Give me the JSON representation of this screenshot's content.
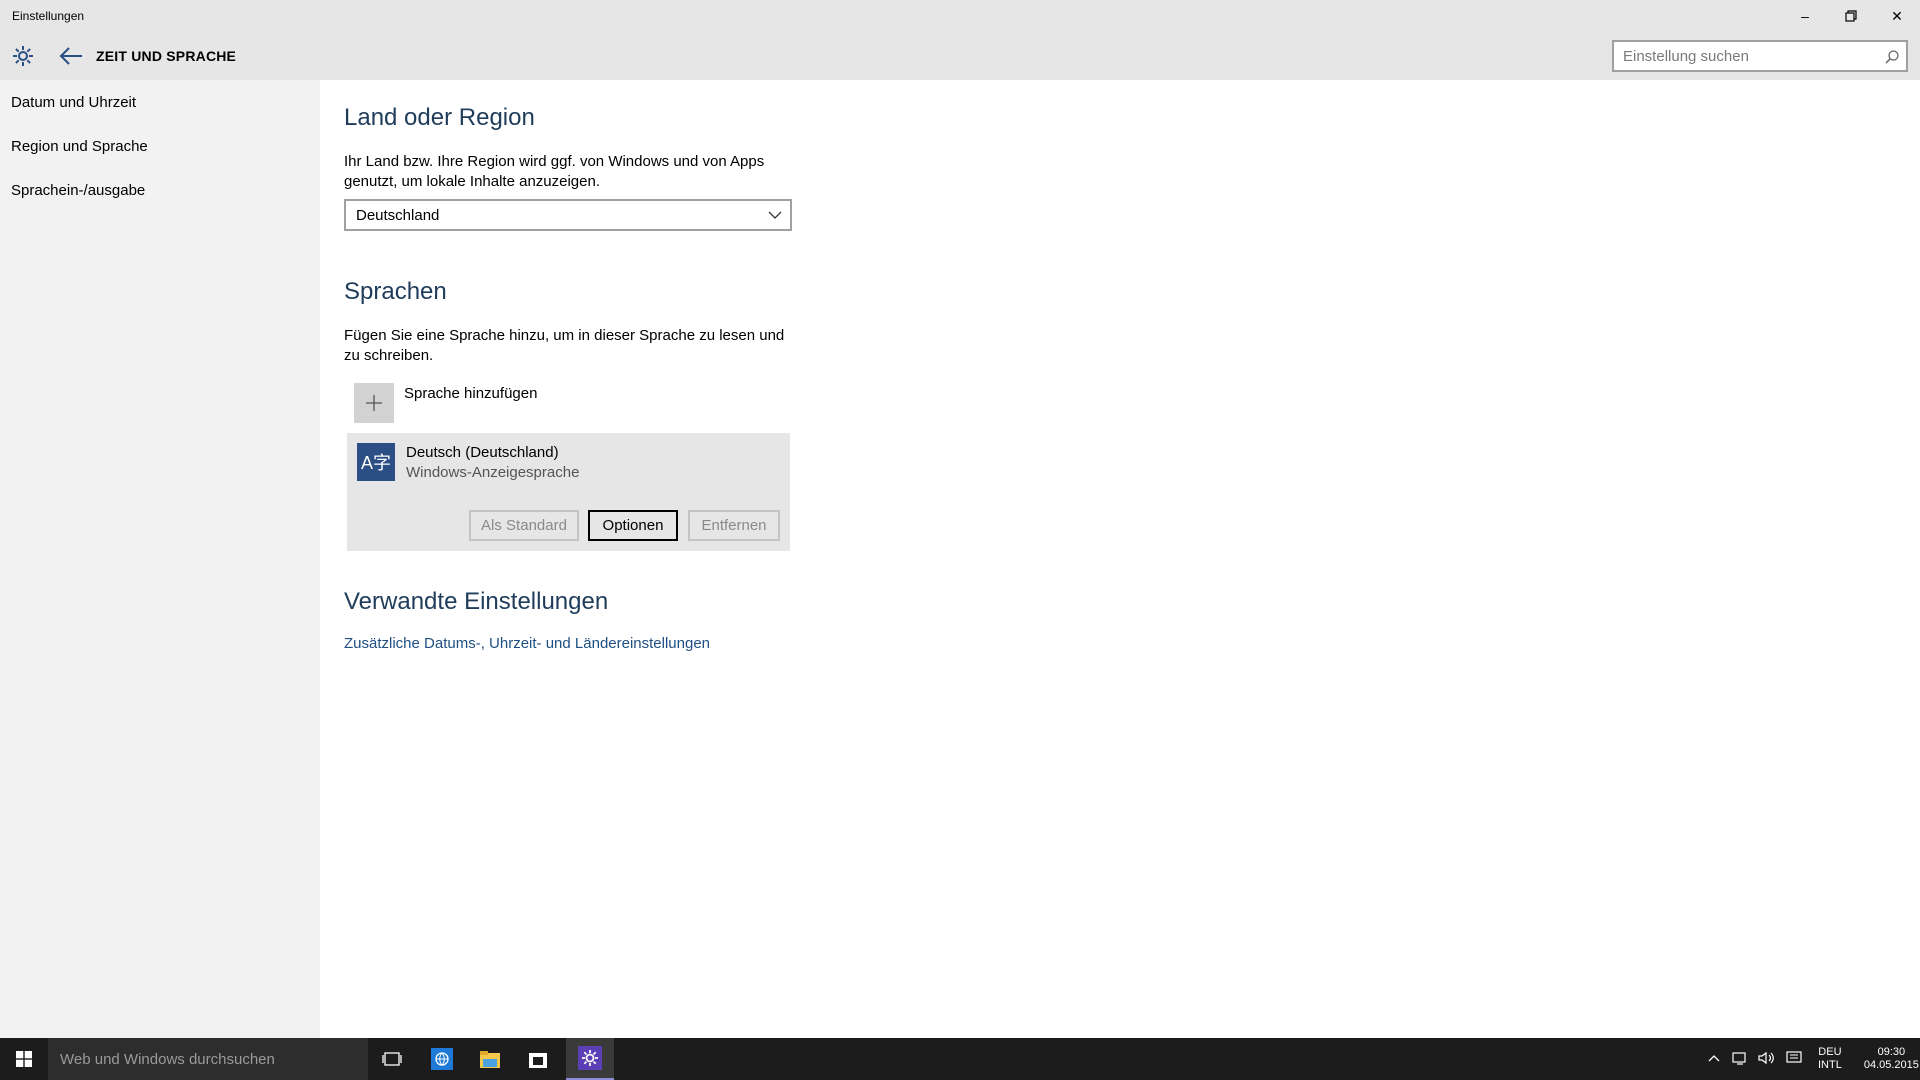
{
  "window": {
    "app_title": "Einstellungen",
    "minimize_glyph": "–",
    "maximize_glyph": "❐",
    "close_glyph": "✕"
  },
  "header": {
    "section_title": "ZEIT UND SPRACHE",
    "search_placeholder": "Einstellung suchen"
  },
  "sidebar": {
    "items": [
      {
        "label": "Datum und Uhrzeit"
      },
      {
        "label": "Region und Sprache"
      },
      {
        "label": "Sprachein-/ausgabe"
      }
    ]
  },
  "main": {
    "region": {
      "heading": "Land oder Region",
      "description": "Ihr Land bzw. Ihre Region wird ggf. von Windows und von Apps genutzt, um lokale Inhalte anzuzeigen.",
      "selected_value": "Deutschland"
    },
    "languages": {
      "heading": "Sprachen",
      "description": "Fügen Sie eine Sprache hinzu, um in dieser Sprache zu lesen und zu schreiben.",
      "add_label": "Sprache hinzufügen",
      "items": [
        {
          "name": "Deutsch (Deutschland)",
          "subtitle": "Windows-Anzeigesprache",
          "icon_glyph": "A字"
        }
      ],
      "buttons": {
        "set_default": "Als Standard",
        "options": "Optionen",
        "remove": "Entfernen"
      }
    },
    "related": {
      "heading": "Verwandte Einstellungen",
      "link": "Zusätzliche Datums-, Uhrzeit- und Ländereinstellungen"
    }
  },
  "taskbar": {
    "search_placeholder": "Web und Windows durchsuchen",
    "tray": {
      "lang_top": "DEU",
      "lang_bottom": "INTL",
      "time": "09:30",
      "date": "04.05.2015"
    }
  },
  "colors": {
    "accent": "#2b4e84",
    "heading": "#1f3c5a",
    "link": "#1f4f82"
  }
}
